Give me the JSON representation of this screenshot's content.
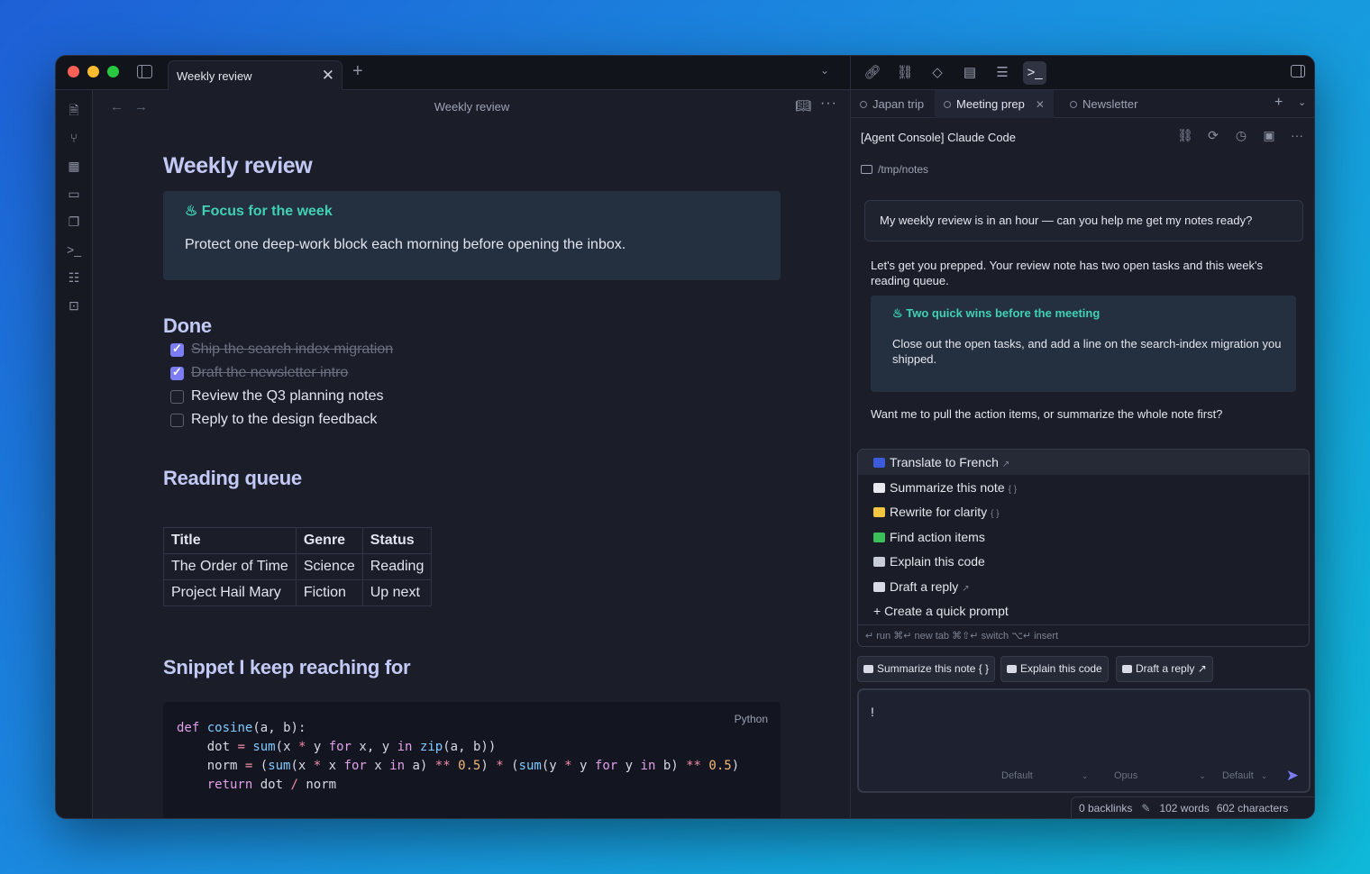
{
  "window": {
    "tab_title": "Weekly review",
    "tab_close": "✕",
    "new_tab": "+",
    "tab_list": "⌄"
  },
  "editor": {
    "header_title": "Weekly review",
    "back": "←",
    "forward": "→",
    "more": "···",
    "h1": "Weekly review",
    "focus_callout": {
      "title": "Focus for the week",
      "body": "Protect one deep-work block each morning before opening the inbox."
    },
    "done_heading": "Done",
    "tasks": [
      {
        "text": "Ship the search index migration",
        "checked": true
      },
      {
        "text": "Draft the newsletter intro",
        "checked": true
      },
      {
        "text": "Review the Q3 planning notes",
        "checked": false
      },
      {
        "text": "Reply to the design feedback",
        "checked": false
      }
    ],
    "reading_heading": "Reading queue",
    "table": {
      "headers": [
        "Title",
        "Genre",
        "Status"
      ],
      "rows": [
        [
          "The Order of Time",
          "Science",
          "Reading"
        ],
        [
          "Project Hail Mary",
          "Fiction",
          "Up next"
        ]
      ]
    },
    "snippet_heading": "Snippet I keep reaching for",
    "code_lang": "Python",
    "code_lines": [
      "def cosine(a, b):",
      "    dot = sum(x * y for x, y in zip(a, b))",
      "    norm = (sum(x * x for x in a) ** 0.5) * (sum(y * y for y in b) ** 0.5)",
      "    return dot / norm"
    ]
  },
  "agent": {
    "tabs": [
      {
        "label": "Japan trip",
        "active": false
      },
      {
        "label": "Meeting prep",
        "active": true
      },
      {
        "label": "Newsletter",
        "active": false
      }
    ],
    "tab_close": "✕",
    "new_tab": "+",
    "tab_chevron": "⌄",
    "title": "[Agent Console] Claude Code",
    "path": "/tmp/notes",
    "user_message": "My weekly review is in an hour — can you help me get my notes ready?",
    "reply_intro": "Let's get you prepped. Your review note has two open tasks and this week's reading queue.",
    "reply_callout": {
      "title": "Two quick wins before the meeting",
      "body": "Close out the open tasks, and add a line on the search-index migration you shipped."
    },
    "reply_question": "Want me to pull the action items, or summarize the whole note first?",
    "quick_prompts": [
      {
        "label": "Translate to French",
        "suffix": "↗",
        "icon_color": "#3b5bdb"
      },
      {
        "label": "Summarize this note",
        "suffix": "{ }",
        "icon_color": "#e8e8ef"
      },
      {
        "label": "Rewrite for clarity",
        "suffix": "{ }",
        "icon_color": "#f5c542"
      },
      {
        "label": "Find action items",
        "suffix": "",
        "icon_color": "#3cbf5a"
      },
      {
        "label": "Explain this code",
        "suffix": "",
        "icon_color": "#c8ccd8"
      },
      {
        "label": "Draft a reply",
        "suffix": "↗",
        "icon_color": "#d8dbe6"
      }
    ],
    "create_prompt": "+ Create a quick prompt",
    "hints": "↵ run   ⌘↵ new tab   ⌘⇧↵ switch   ⌥↵ insert",
    "chips": [
      {
        "label": "Summarize this note",
        "suffix": "{ }"
      },
      {
        "label": "Explain this code",
        "suffix": ""
      },
      {
        "label": "Draft a reply",
        "suffix": "↗"
      }
    ],
    "composer": {
      "value": "!",
      "mode": "Default",
      "model": "Opus",
      "effort": "Default",
      "chevron": "⌄",
      "send": "➤"
    }
  },
  "status_bar": {
    "backlinks": "0 backlinks",
    "words": "102 words",
    "characters": "602 characters"
  },
  "colors": {
    "accent": "#7c7cf5",
    "callout_title": "#3fd1b2",
    "heading": "#c3c9f5",
    "background": "#1b1e29"
  }
}
